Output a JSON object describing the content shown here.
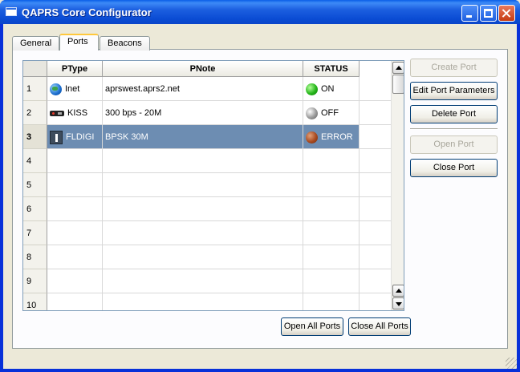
{
  "window": {
    "title": "QAPRS Core Configurator"
  },
  "tabs": [
    {
      "label": "General",
      "active": false
    },
    {
      "label": "Ports",
      "active": true
    },
    {
      "label": "Beacons",
      "active": false
    }
  ],
  "grid": {
    "columns": [
      "PType",
      "PNote",
      "STATUS"
    ],
    "rows": [
      {
        "num": "1",
        "ptype": "Inet",
        "ptype_icon": "globe-icon",
        "pnote": "aprswest.aprs2.net",
        "status": "ON",
        "status_color": "#25b51a"
      },
      {
        "num": "2",
        "ptype": "KISS",
        "ptype_icon": "radio-icon",
        "pnote": "300 bps - 20M",
        "status": "OFF",
        "status_color": "#9a9a9a"
      },
      {
        "num": "3",
        "ptype": "FLDIGI",
        "ptype_icon": "fldigi-icon",
        "pnote": "BPSK 30M",
        "status": "ERROR",
        "status_color": "#a84a20",
        "selected": true
      },
      {
        "num": "4"
      },
      {
        "num": "5"
      },
      {
        "num": "6"
      },
      {
        "num": "7"
      },
      {
        "num": "8"
      },
      {
        "num": "9"
      },
      {
        "num": "10"
      }
    ]
  },
  "side_buttons": {
    "create_port": "Create Port",
    "edit_port_parameters": "Edit Port Parameters",
    "delete_port": "Delete Port",
    "open_port": "Open Port",
    "close_port": "Close Port"
  },
  "bottom_buttons": {
    "open_all_ports": "Open All Ports",
    "close_all_ports": "Close All Ports"
  },
  "colors": {
    "selection": "#6d8db2",
    "title_bar": "#0a4bd3"
  }
}
